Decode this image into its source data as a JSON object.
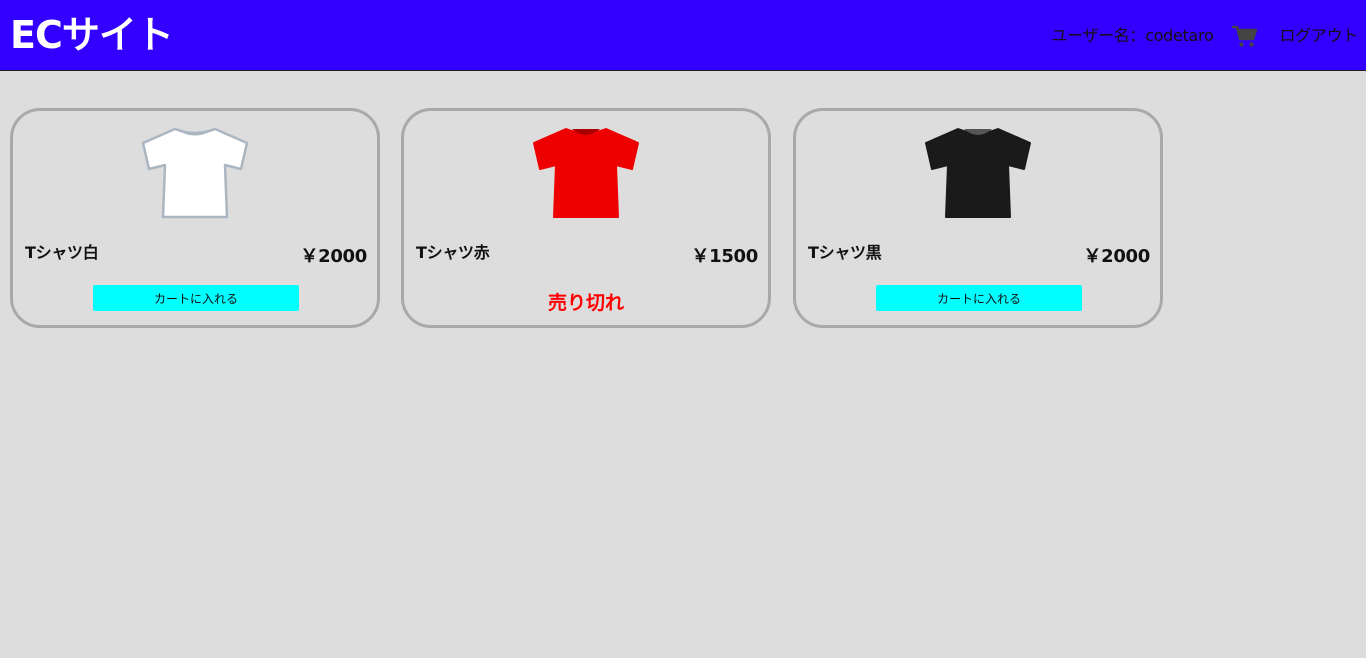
{
  "header": {
    "title": "ECサイト",
    "user_label": "ユーザー名：codetaro",
    "cart_icon": "shopping-cart-icon",
    "logout_label": "ログアウト",
    "background_color": "#3300ff"
  },
  "products": [
    {
      "name": "Tシャツ白",
      "price": "￥2000",
      "image_icon": "white-tshirt",
      "shirt_color": "#ffffff",
      "action_label": "カートに入れる",
      "status": "available"
    },
    {
      "name": "Tシャツ赤",
      "price": "￥1500",
      "image_icon": "red-tshirt",
      "shirt_color": "#ee0000",
      "status_label": "売り切れ",
      "status": "sold_out"
    },
    {
      "name": "Tシャツ黒",
      "price": "￥2000",
      "image_icon": "black-tshirt",
      "shirt_color": "#1a1a1a",
      "action_label": "カートに入れる",
      "status": "available"
    }
  ],
  "colors": {
    "button": "#00ffff",
    "sold_out": "#ff0000",
    "card_border": "#a9a9a9",
    "page_background": "#dddddd"
  }
}
